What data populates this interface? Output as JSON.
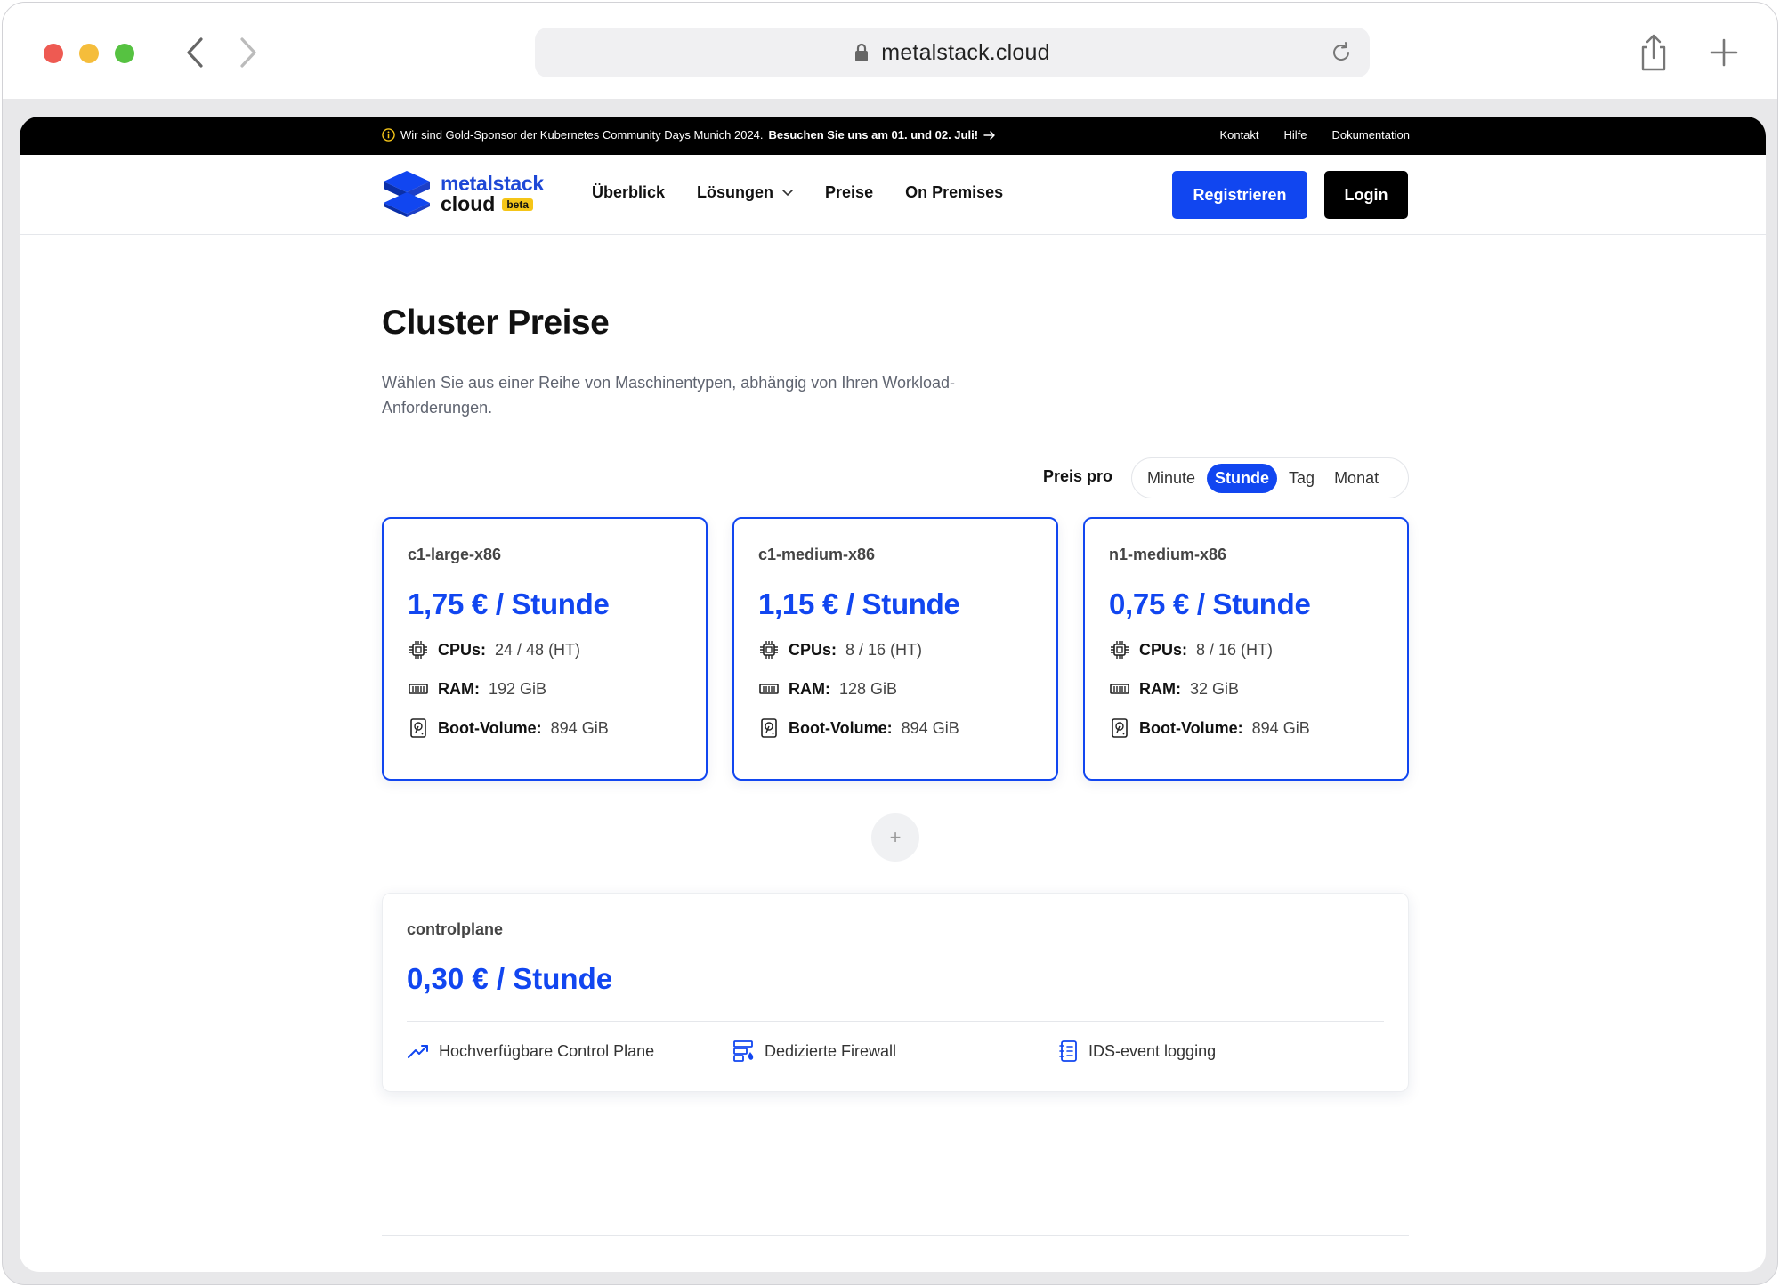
{
  "browser": {
    "url": "metalstack.cloud"
  },
  "announcement": {
    "text": "Wir sind Gold-Sponsor der Kubernetes Community Days Munich 2024.",
    "cta": "Besuchen Sie uns am 01. und 02. Juli!"
  },
  "top_links": [
    "Kontakt",
    "Hilfe",
    "Dokumentation"
  ],
  "logo": {
    "line1": "metalstack",
    "line2": "cloud",
    "badge": "beta"
  },
  "nav": {
    "items": [
      "Überblick",
      "Lösungen",
      "Preise",
      "On Premises"
    ],
    "register": "Registrieren",
    "login": "Login"
  },
  "page": {
    "title": "Cluster Preise",
    "subtitle": "Wählen Sie aus einer Reihe von Maschinentypen, abhängig von Ihren Workload-Anforderungen."
  },
  "price_toggle": {
    "label": "Preis pro",
    "options": [
      "Minute",
      "Stunde",
      "Tag",
      "Monat"
    ],
    "selected": "Stunde"
  },
  "labels": {
    "cpus": "CPUs:",
    "ram": "RAM:",
    "boot": "Boot-Volume:"
  },
  "machines": [
    {
      "name": "c1-large-x86",
      "price": "1,75 € / Stunde",
      "cpus": "24 / 48 (HT)",
      "ram": "192 GiB",
      "boot": "894 GiB"
    },
    {
      "name": "c1-medium-x86",
      "price": "1,15 € / Stunde",
      "cpus": "8 / 16 (HT)",
      "ram": "128 GiB",
      "boot": "894 GiB"
    },
    {
      "name": "n1-medium-x86",
      "price": "0,75 € / Stunde",
      "cpus": "8 / 16 (HT)",
      "ram": "32 GiB",
      "boot": "894 GiB"
    }
  ],
  "plus_symbol": "+",
  "controlplane": {
    "name": "controlplane",
    "price": "0,30 € / Stunde",
    "features": [
      "Hochverfügbare Control Plane",
      "Dedizierte Firewall",
      "IDS-event logging"
    ]
  },
  "colors": {
    "accent": "#1146f0",
    "topbar": "#000000"
  }
}
